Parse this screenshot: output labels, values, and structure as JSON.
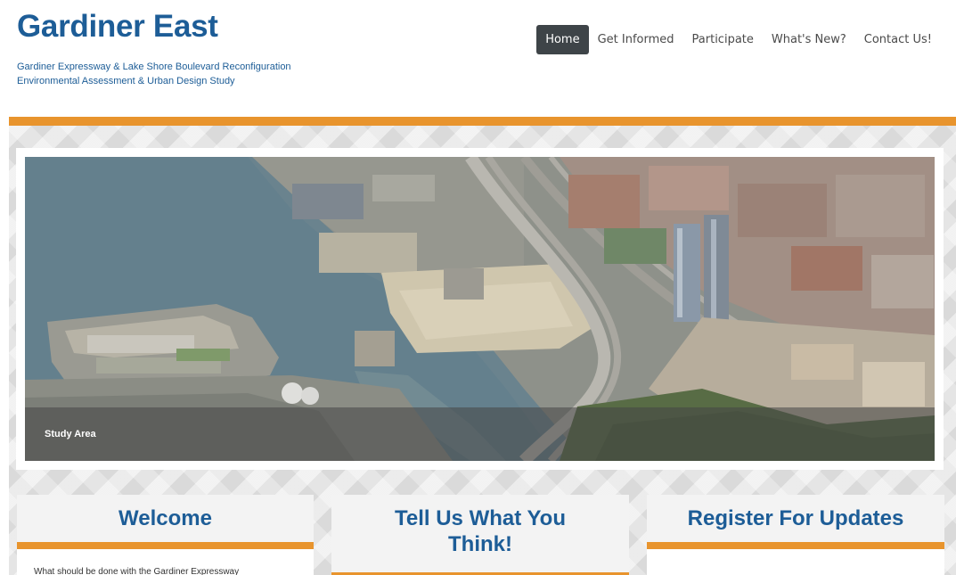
{
  "header": {
    "title": "Gardiner East",
    "tagline_line1": "Gardiner Expressway & Lake Shore Boulevard Reconfiguration",
    "tagline_line2": "Environmental Assessment & Urban Design Study"
  },
  "nav": {
    "items": [
      "Home",
      "Get Informed",
      "Participate",
      "What's New?",
      "Contact Us!"
    ],
    "active": "Home"
  },
  "hero": {
    "caption": "Study Area"
  },
  "cards": {
    "welcome": {
      "heading": "Welcome",
      "body": "What should be done with the Gardiner Expressway"
    },
    "tell": {
      "heading_line1": "Tell Us What You",
      "heading_line2": "Think!"
    },
    "register": {
      "heading": "Register For Updates"
    }
  },
  "colors": {
    "brand_blue": "#1d5d97",
    "accent_orange": "#e8942d",
    "nav_active_bg": "#3e4448"
  }
}
